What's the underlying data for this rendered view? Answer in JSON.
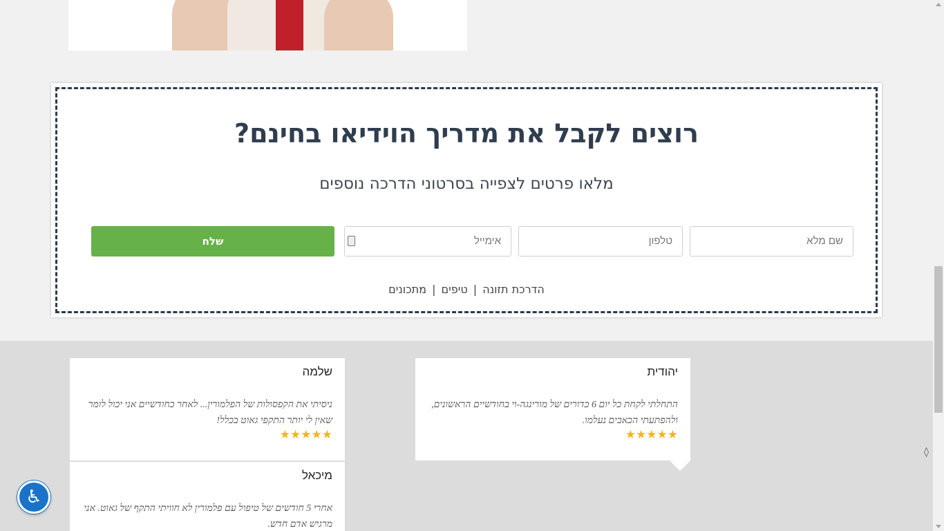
{
  "form": {
    "title": "רוצים לקבל את מדריך הוידיאו בחינם?",
    "subtitle": "מלאו פרטים לצפייה בסרטוני הדרכה נוספים",
    "name_placeholder": "שם מלא",
    "phone_placeholder": "טלפון",
    "email_placeholder": "אימייל",
    "send_label": "שלח",
    "tags": [
      "הדרכת תזונה",
      "טיפים",
      "מתכונים"
    ],
    "tag_separator": "|"
  },
  "testimonials": [
    {
      "name": "יהודית",
      "quote": "התחלתי לקחת כל יום 6 כדורים של מורינגה-וי בחודשיים הראשונים, ולהפתעתי הכאבים נעלמו.",
      "stars": "★★★★★"
    },
    {
      "name": "שלמה",
      "quote": "ניסיתי את הקפסולות של הפלמורין... לאחר כחודשיים אני יכול לומר שאין לי יותר התקפי גאוט בכלל!",
      "stars": "★★★★★"
    },
    {
      "name": "מיכאל",
      "quote": "אחרי 5 חודשים של טיפול עם פלמורין לא חוויתי התקף של גאוט. אני מרגיש אדם חדש.",
      "stars": "★★★★★"
    }
  ],
  "accessibility": {
    "icon": "accessibility-icon",
    "glyph": "♿"
  },
  "colors": {
    "send_button": "#67b248",
    "title": "#2f3d4d",
    "stars": "#f2b51c",
    "a11y": "#1a73c8"
  }
}
